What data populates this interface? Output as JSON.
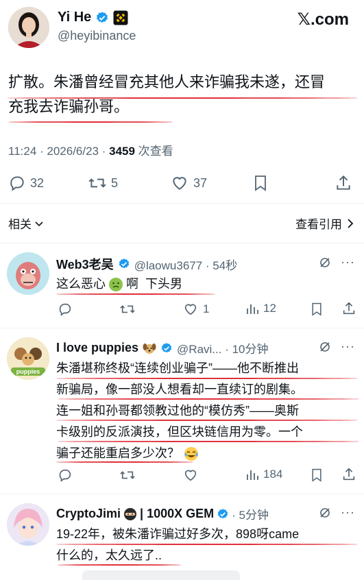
{
  "author": {
    "name": "Yi He",
    "handle": "@heyibinance"
  },
  "brand": "𝕏.com",
  "post": {
    "text_line1": "扩散。朱潘曾经冒充其他人来诈骗我未遂，还冒",
    "text_line2": "充我去诈骗孙哥。",
    "time": "11:24 · 2026/6/23 · ",
    "views": "3459",
    "views_label": " 次查看",
    "stats": {
      "replies": "32",
      "reposts": "5",
      "likes": "37"
    }
  },
  "filter": {
    "related": "相关",
    "view_quotes": "查看引用"
  },
  "replies": [
    {
      "name": "Web3老吴",
      "meta": "@laowu3677 · 54秒",
      "text": [
        "这么恶心",
        "啊  下头男"
      ],
      "stats": {
        "replies": "",
        "reposts": "",
        "likes": "1",
        "views": "12"
      }
    },
    {
      "name": "I love puppies",
      "meta": "@Ravi... · 10分钟",
      "avatar_label": "puppies",
      "text": [
        "朱潘堪称终极“连续创业骗子”——他不断推出",
        "新骗局，像一部没人想看却一直续订的剧集。",
        "连一姐和孙哥都领教过他的“模仿秀”——奥斯",
        "卡级别的反派演技，但区块链信用为零。一个",
        "骗子还能重启多少次？"
      ],
      "stats": {
        "replies": "",
        "reposts": "",
        "likes": "",
        "views": "184"
      }
    },
    {
      "name": "CryptoJimi",
      "name_suffix": "| 1000X GEM",
      "meta": "· 5分钟",
      "text": [
        "19-22年，被朱潘诈骗过好多次，898呀came",
        "什么的，太久远了.."
      ]
    }
  ],
  "colors": {
    "accent": "#1d9bf0",
    "text": "#0f1419",
    "muted": "#536471",
    "underline": "#e0303a",
    "binance": "#f0b90b"
  }
}
